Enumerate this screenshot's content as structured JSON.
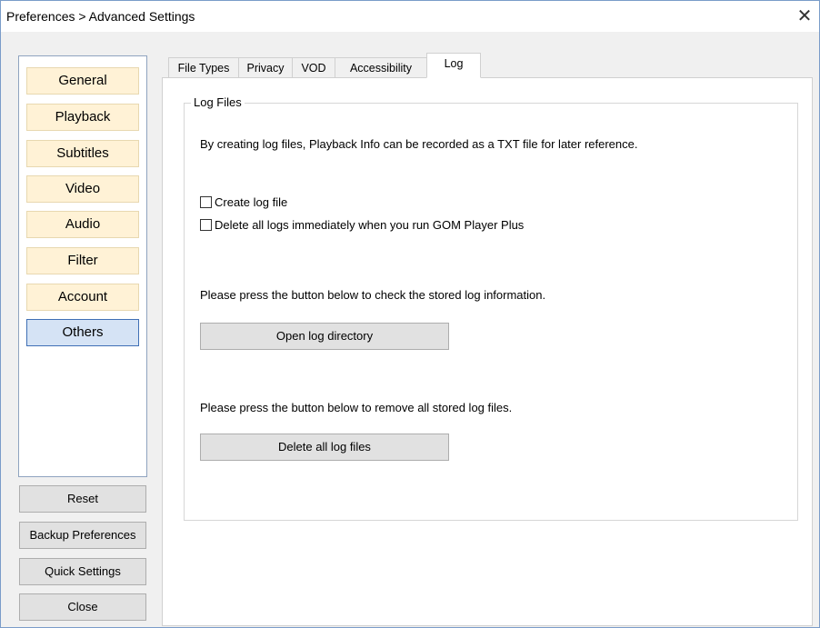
{
  "window": {
    "title": "Preferences > Advanced Settings",
    "close_glyph": "✕"
  },
  "sidebar": {
    "items": [
      {
        "label": "General"
      },
      {
        "label": "Playback"
      },
      {
        "label": "Subtitles"
      },
      {
        "label": "Video"
      },
      {
        "label": "Audio"
      },
      {
        "label": "Filter"
      },
      {
        "label": "Account"
      },
      {
        "label": "Others",
        "selected": true
      }
    ],
    "reset": "Reset",
    "backup": "Backup Preferences",
    "quick": "Quick Settings",
    "close": "Close"
  },
  "tabs": [
    {
      "label": "File Types"
    },
    {
      "label": "Privacy"
    },
    {
      "label": "VOD"
    },
    {
      "label": "Accessibility"
    },
    {
      "label": "Log",
      "active": true
    }
  ],
  "log": {
    "group_title": "Log Files",
    "description": "By creating log files, Playback Info can be recorded as a TXT file for later reference.",
    "create_log": {
      "label": "Create log file",
      "checked": false
    },
    "delete_logs": {
      "label": "Delete all logs immediately when you run GOM Player Plus",
      "checked": false
    },
    "check_info": "Please press the button below to check the stored log information.",
    "open_dir_button": "Open log directory",
    "remove_info": "Please press the button below to remove all stored log files.",
    "delete_button": "Delete all log files"
  },
  "colors": {
    "nav_button_bg": "#fff2d6",
    "nav_selected_bg": "#d5e3f5",
    "nav_selected_border": "#3f6fb5",
    "window_border": "#7a9cc9"
  }
}
